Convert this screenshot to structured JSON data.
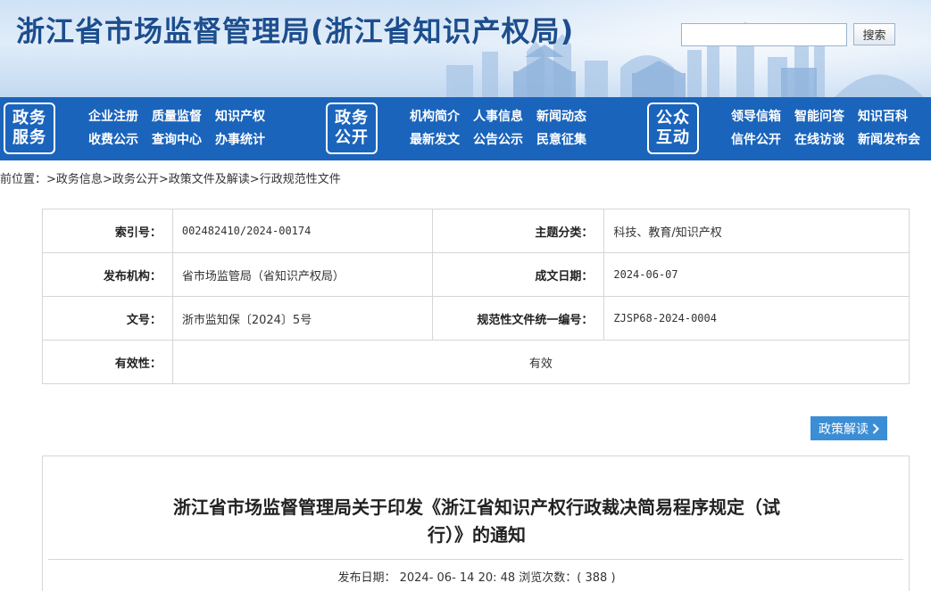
{
  "header": {
    "title": "浙江省市场监督管理局(浙江省知识产权局)",
    "search": {
      "placeholder": "",
      "value": "",
      "button_label": "搜索"
    }
  },
  "nav": {
    "groups": [
      {
        "badge": [
          "政务",
          "服务"
        ],
        "rows": [
          [
            "企业注册",
            "质量监督",
            "知识产权"
          ],
          [
            "收费公示",
            "查询中心",
            "办事统计"
          ]
        ]
      },
      {
        "badge": [
          "政务",
          "公开"
        ],
        "rows": [
          [
            "机构简介",
            "人事信息",
            "新闻动态"
          ],
          [
            "最新发文",
            "公告公示",
            "民意征集"
          ]
        ]
      },
      {
        "badge": [
          "公众",
          "互动"
        ],
        "rows": [
          [
            "领导信箱",
            "智能问答",
            "知识百科"
          ],
          [
            "信件公开",
            "在线访谈",
            "新闻发布会"
          ]
        ]
      }
    ]
  },
  "breadcrumb": {
    "prefix": "前位置：",
    "items": [
      "政务信息",
      "政务公开",
      "政策文件及解读",
      "行政规范性文件"
    ],
    "separator": ">"
  },
  "meta": {
    "index_label": "索引号：",
    "index_value": "002482410/2024-00174",
    "category_label": "主题分类：",
    "category_value": "科技、教育/知识产权",
    "publisher_label": "发布机构：",
    "publisher_value": "省市场监管局（省知识产权局）",
    "date_label": "成文日期：",
    "date_value": "2024-06-07",
    "docno_label": "文号：",
    "docno_value": "浙市监知保〔2024〕5号",
    "code_label": "规范性文件统一编号：",
    "code_value": "ZJSP68-2024-0004",
    "validity_label": "有效性：",
    "validity_value": "有效"
  },
  "policy_button": {
    "label": "政策解读"
  },
  "article": {
    "title_line1": "浙江省市场监督管理局关于印发《浙江省知识产权行政裁决简易程序规定（试",
    "title_line2": "行）》的通知",
    "meta_line": "发布日期： 2024- 06- 14 20: 48 浏览次数：( 388 )"
  },
  "colors": {
    "nav_bg": "#1a64bc",
    "title": "#1c4e8e",
    "policy_button": "#3b8ed6"
  }
}
